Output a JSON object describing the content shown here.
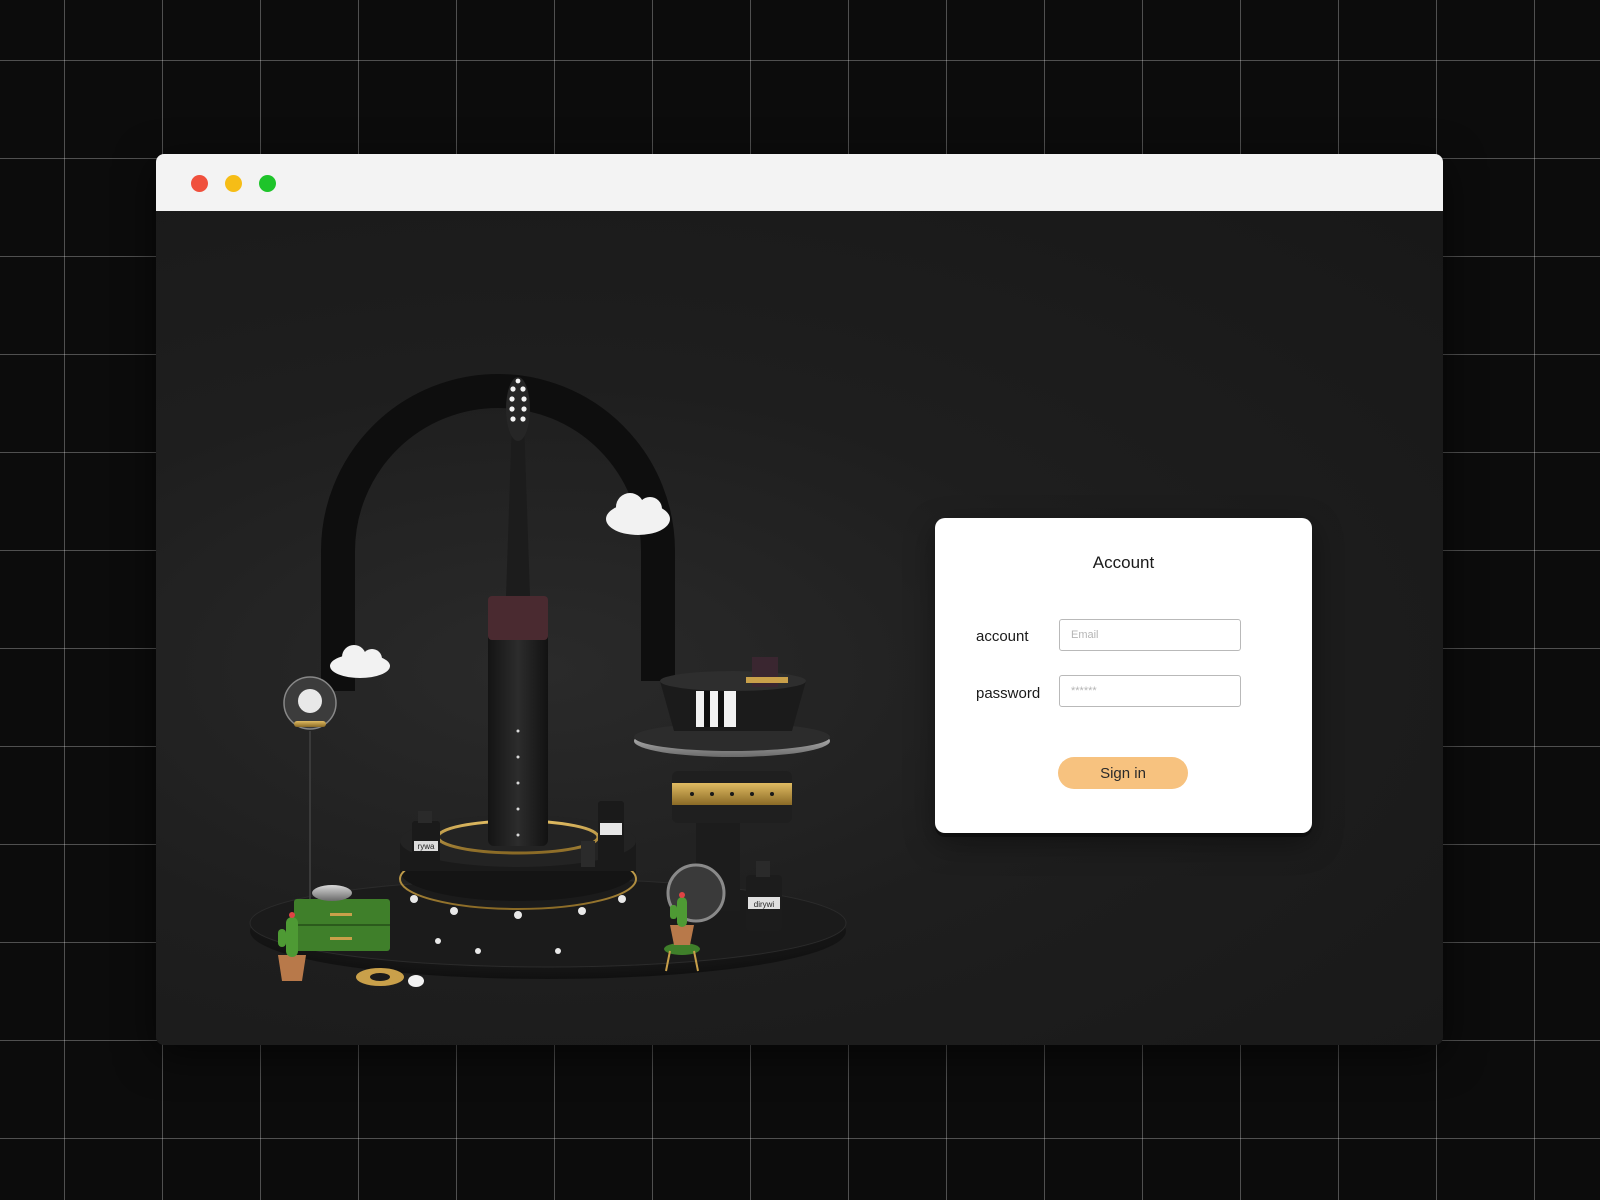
{
  "window": {
    "controls": [
      {
        "name": "close",
        "color": "#f0503c"
      },
      {
        "name": "minimize",
        "color": "#f6bd16"
      },
      {
        "name": "maximize",
        "color": "#1ec42a"
      }
    ]
  },
  "scene": {
    "illustration": "toothbrush-3d-scene",
    "bottle_label_1": "rywa",
    "bottle_label_2": "dirywi"
  },
  "login": {
    "title": "Account",
    "account_label": "account",
    "account_placeholder": "Email",
    "password_label": "password",
    "password_placeholder": "******",
    "signin_label": "Sign in"
  },
  "colors": {
    "accent": "#f7c27f",
    "card_bg": "#ffffff",
    "content_bg": "#1e1e1e",
    "gold": "#c9a04a",
    "brush_ring": "#4a2a30",
    "plant_green": "#3f7f2a"
  }
}
